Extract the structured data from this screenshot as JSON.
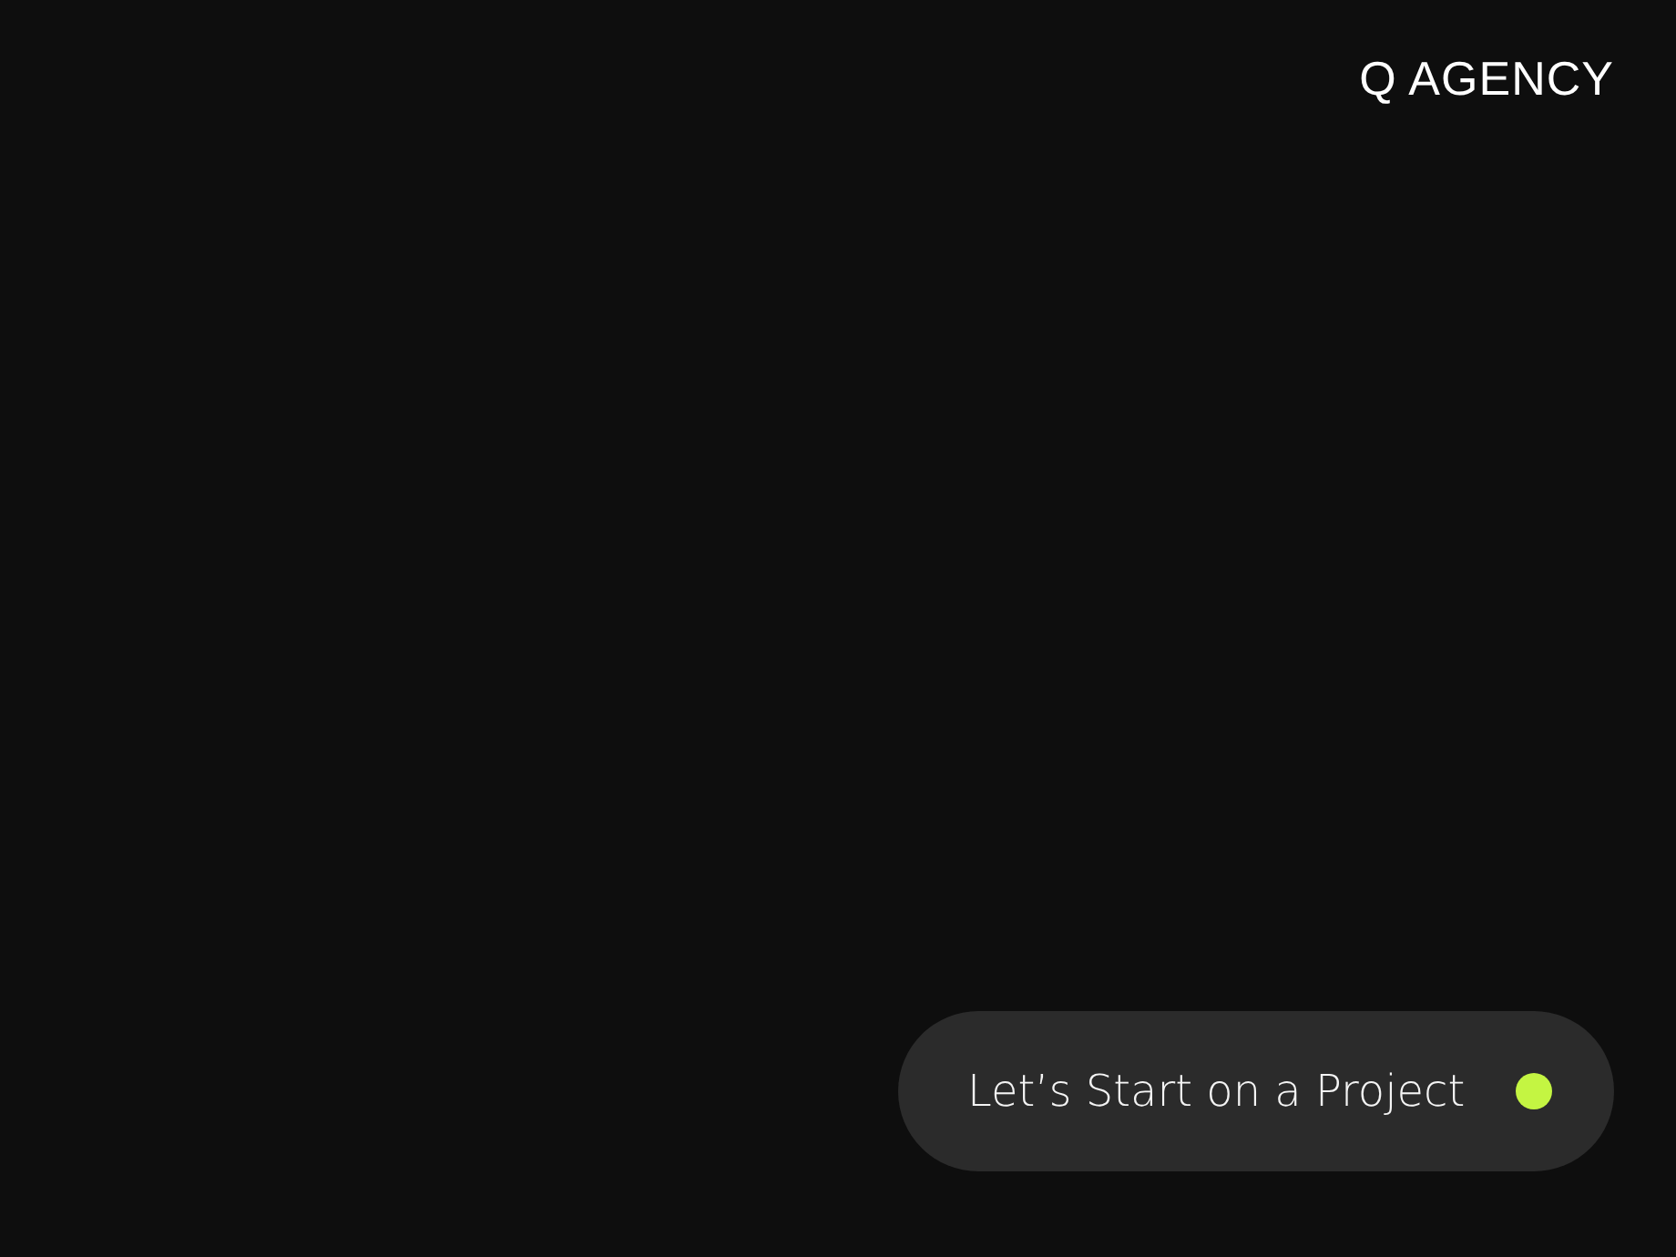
{
  "header": {
    "logo": "Q AGENCY"
  },
  "cta_button": {
    "label": "Let’s Start on a Project"
  }
}
